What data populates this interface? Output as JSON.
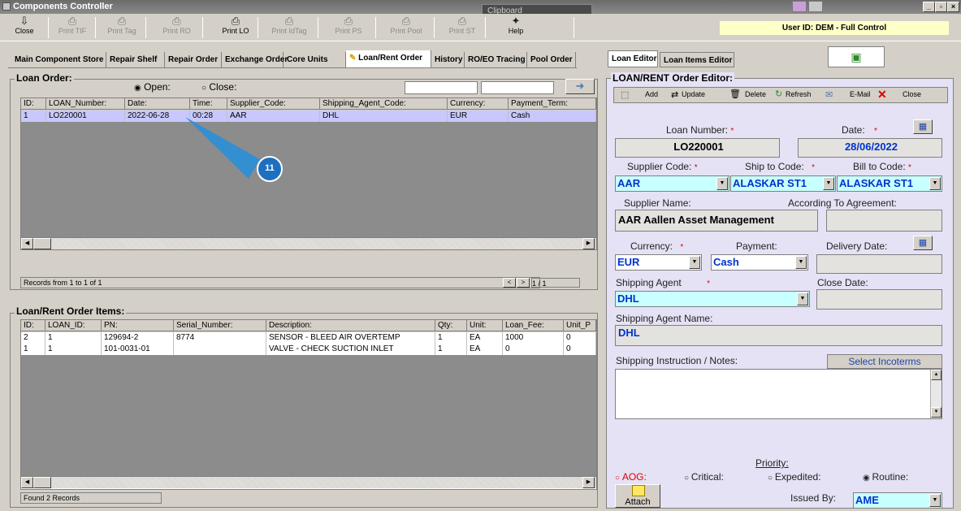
{
  "window": {
    "title": "Components Controller",
    "clipboard_label": "Clipboard",
    "user_info": "User ID: DEM - Full Control"
  },
  "toolbar": [
    {
      "label": "Close",
      "icon": "close-icon",
      "enabled": true
    },
    {
      "label": "Print TIF",
      "icon": "printer-icon",
      "enabled": false
    },
    {
      "label": "Print Tag",
      "icon": "printer-icon",
      "enabled": false
    },
    {
      "label": "Print RO",
      "icon": "printer-icon",
      "enabled": false
    },
    {
      "label": "Print LO",
      "icon": "printer-icon",
      "enabled": true
    },
    {
      "label": "Print IdTag",
      "icon": "printer-icon",
      "enabled": false
    },
    {
      "label": "Print PS",
      "icon": "printer-icon",
      "enabled": false
    },
    {
      "label": "Print Pool",
      "icon": "printer-icon",
      "enabled": false
    },
    {
      "label": "Print ST",
      "icon": "printer-icon",
      "enabled": false
    },
    {
      "label": "Help",
      "icon": "help-book-icon",
      "enabled": true
    }
  ],
  "tabs": [
    "Main Component Store",
    "Repair Shelf",
    "Repair Order",
    "Exchange Order",
    "Core Units",
    "Loan/Rent Order",
    "History",
    "RO/EO Tracing",
    "Pool Order"
  ],
  "right_tabs": [
    "Loan Editor",
    "Loan Items Editor"
  ],
  "loan_order": {
    "title": "Loan Order:",
    "filter_open": "Open:",
    "filter_close": "Close:",
    "columns": [
      "ID:",
      "LOAN_Number:",
      "Date:",
      "Time:",
      "Supplier_Code:",
      "Shipping_Agent_Code:",
      "Currency:",
      "Payment_Term:"
    ],
    "rows": [
      [
        "1",
        "LO220001",
        "2022-06-28",
        "00:28",
        "AAR",
        "DHL",
        "EUR",
        "Cash"
      ]
    ],
    "records_text": "Records from 1 to 1 of 1",
    "nav_prev": "<",
    "nav_next": ">",
    "page_text": "1 / 1",
    "callout_number": "11"
  },
  "items": {
    "title": "Loan/Rent Order Items:",
    "columns": [
      "ID:",
      "LOAN_ID:",
      "PN:",
      "Serial_Number:",
      "Description:",
      "Qty:",
      "Unit:",
      "Loan_Fee:",
      "Unit_P"
    ],
    "rows": [
      [
        "2",
        "1",
        "129694-2",
        "8774",
        "SENSOR - BLEED AIR OVERTEMP",
        "1",
        "EA",
        "1000",
        "0"
      ],
      [
        "1",
        "1",
        "101-0031-01",
        "",
        "VALVE - CHECK SUCTION INLET",
        "1",
        "EA",
        "0",
        "0"
      ]
    ],
    "found_text": "Found 2 Records"
  },
  "editor": {
    "title": "LOAN/RENT Order Editor:",
    "toolbar": {
      "add": "Add",
      "update": "Update",
      "delete": "Delete",
      "refresh": "Refresh",
      "email": "E-Mail",
      "close": "Close"
    },
    "loan_number_label": "Loan Number:",
    "loan_number": "LO220001",
    "date_label": "Date:",
    "date": "28/06/2022",
    "supplier_code_label": "Supplier Code:",
    "supplier_code": "AAR",
    "ship_to_label": "Ship to Code:",
    "ship_to": "ALASKAR ST1",
    "bill_to_label": "Bill to Code:",
    "bill_to": "ALASKAR ST1",
    "supplier_name_label": "Supplier Name:",
    "supplier_name": "AAR Aallen Asset Management",
    "agreement_label": "According To Agreement:",
    "agreement": "",
    "currency_label": "Currency:",
    "currency": "EUR",
    "payment_label": "Payment:",
    "payment": "Cash",
    "delivery_label": "Delivery Date:",
    "delivery": "",
    "shipping_agent_label": "Shipping Agent",
    "shipping_agent": "DHL",
    "close_date_label": "Close Date:",
    "close_date": "",
    "shipping_agent_name_label": "Shipping Agent Name:",
    "shipping_agent_name": "DHL",
    "notes_label": "Shipping Instruction / Notes:",
    "incoterms_button": "Select Incoterms",
    "notes": "",
    "priority_label": "Priority:",
    "priority_options": [
      "AOG:",
      "Critical:",
      "Expedited:",
      "Routine:"
    ],
    "priority_selected": "Routine:",
    "attach_label": "Attach",
    "issued_by_label": "Issued By:",
    "issued_by": "AME"
  }
}
